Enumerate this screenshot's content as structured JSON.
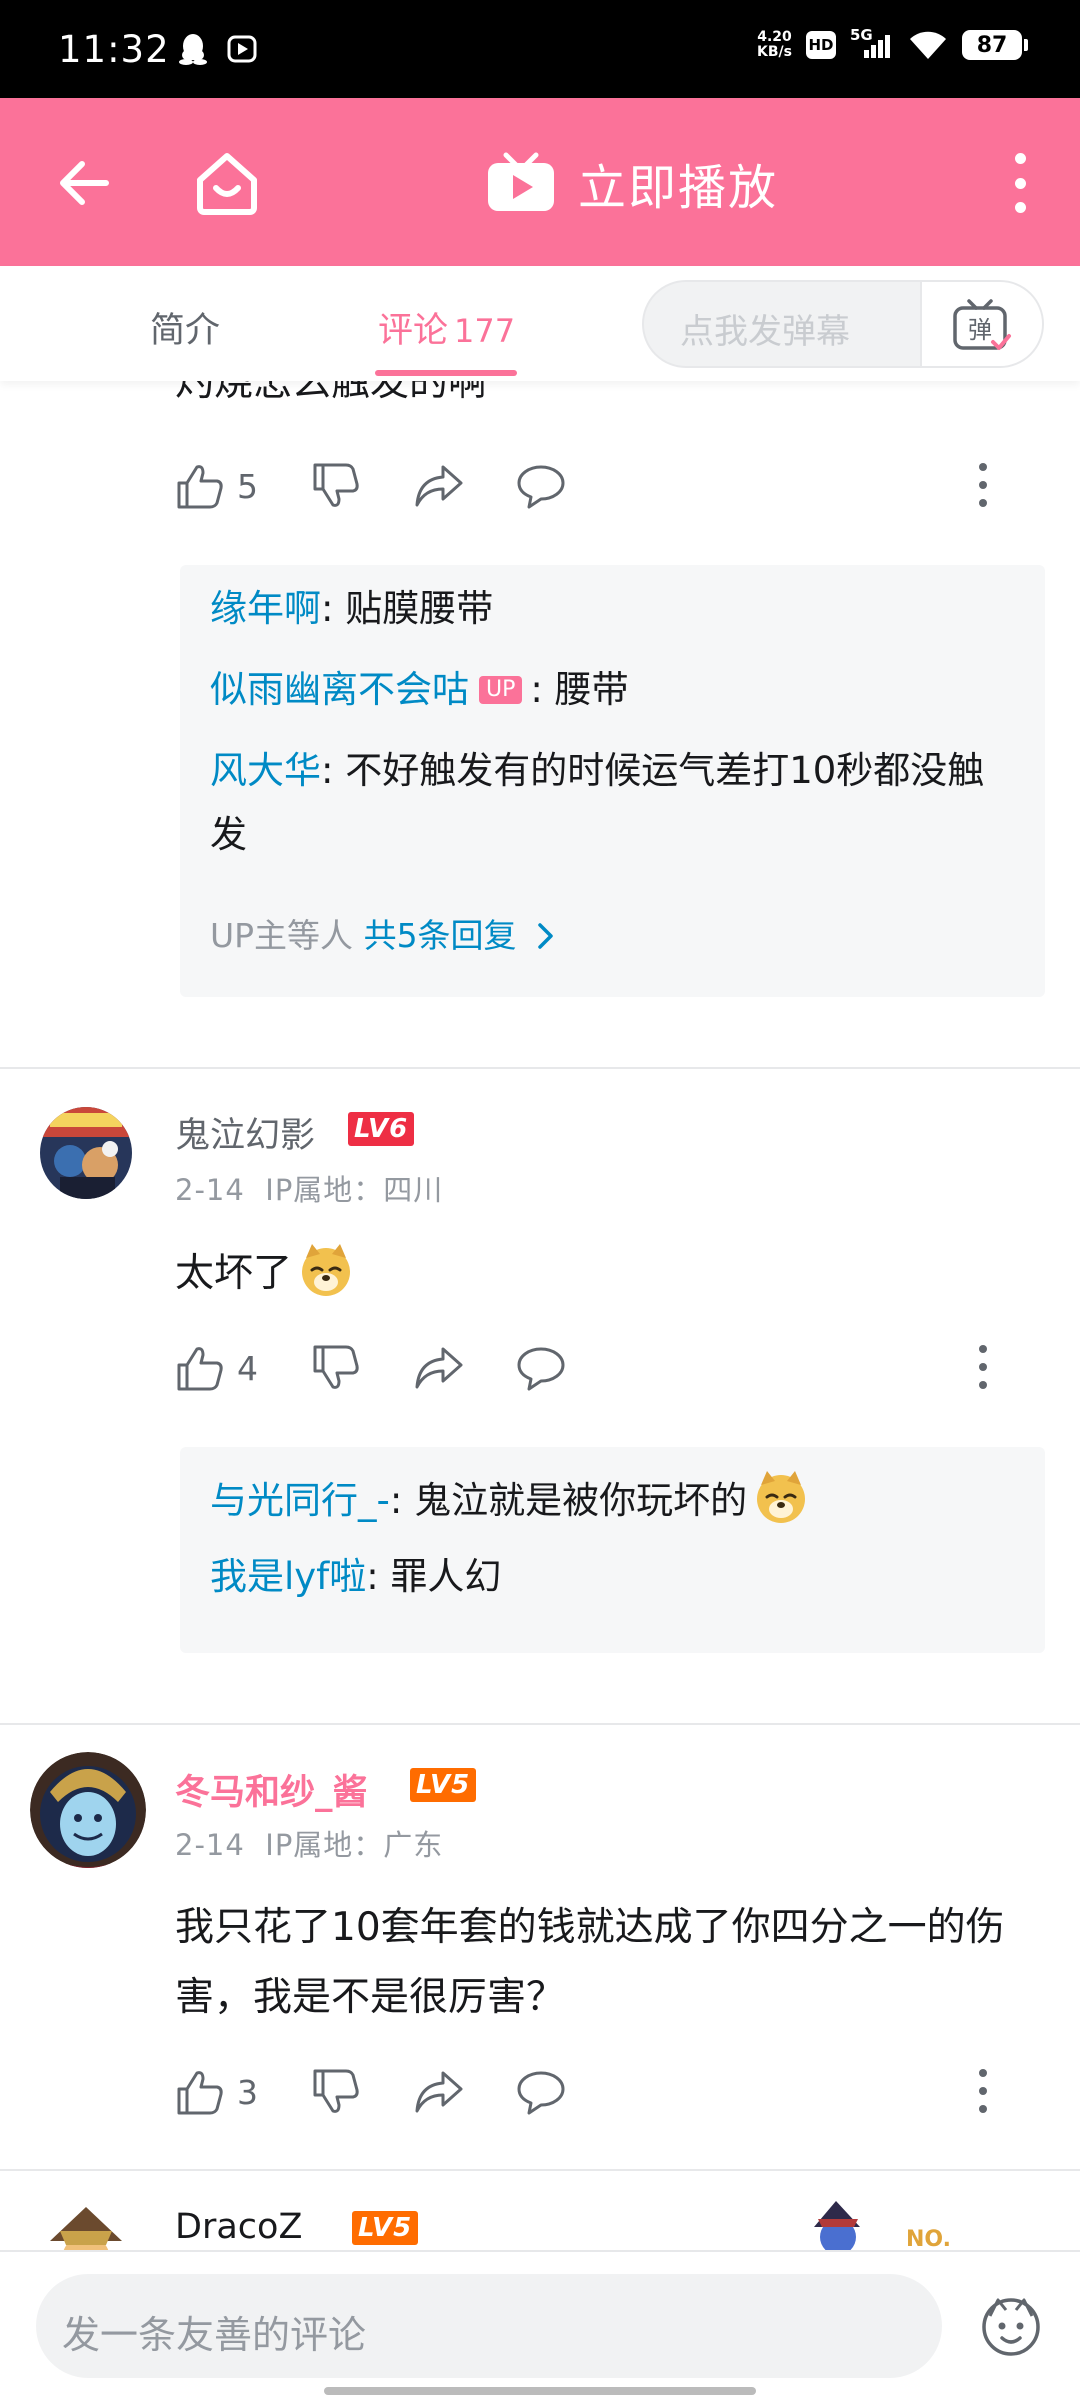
{
  "status_bar": {
    "time": "11:32",
    "net_speed_value": "4.20",
    "net_speed_unit": "KB/s",
    "hd": "HD",
    "network": "5G",
    "battery": "87"
  },
  "header": {
    "play_now_label": "立即播放"
  },
  "tabs": {
    "intro": "简介",
    "comments": "评论",
    "comments_count": "177",
    "danmaku_placeholder": "点我发弹幕",
    "danmaku_button": "弹"
  },
  "comments": [
    {
      "text": "灼烧怎么触发的啊",
      "likes": "5",
      "replies": [
        {
          "user": "缘年啊",
          "text": ": 贴膜腰带"
        },
        {
          "user": "似雨幽离不会咕",
          "badge": "UP",
          "text": ": 腰带"
        },
        {
          "user": "风大华",
          "text": ": 不好触发有的时候运气差打10秒都没触发"
        }
      ],
      "reply_summary_prefix": "UP主等人",
      "reply_summary_link": "共5条回复"
    },
    {
      "user": "鬼泣幻影",
      "level": "LV6",
      "date": "2-14",
      "ip": "IP属地：四川",
      "text": "太坏了",
      "likes": "4",
      "replies": [
        {
          "user": "与光同行_-",
          "text": ": 鬼泣就是被你玩坏的"
        },
        {
          "user": "我是lyf啦",
          "text": ": 罪人幻"
        }
      ]
    },
    {
      "user": "冬马和纱_酱",
      "level": "LV5",
      "date": "2-14",
      "ip": "IP属地：广东",
      "text": "我只花了10套年套的钱就达成了你四分之一的伤害，我是不是很厉害？",
      "likes": "3"
    },
    {
      "user": "DracoZ",
      "level": "LV5",
      "badge_text": "NO."
    }
  ],
  "bottom": {
    "input_placeholder": "发一条友善的评论"
  },
  "colors": {
    "brand_pink": "#fb7299",
    "link_blue": "#008ac5",
    "lv6": "#ee2e44",
    "lv5": "#ff6c00"
  }
}
